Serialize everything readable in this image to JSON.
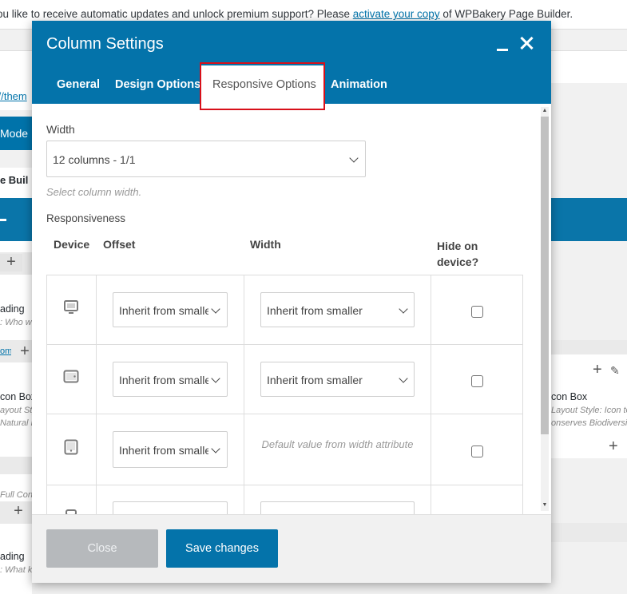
{
  "background": {
    "notice": {
      "text_before": "ou like to receive automatic updates and unlock premium support? Please ",
      "link": "activate your copy",
      "text_after": " of WPBakery Page Builder."
    },
    "url_fragment": "://them",
    "mode_label": "Mode",
    "builder_title": "ge Buil",
    "left_items": [
      {
        "title": "ading",
        "subtitle": ": Who w"
      },
      {
        "title": "con Box",
        "subtitle": "ayout Sty",
        "subtitle2": "Natural F"
      },
      {
        "title": "ading",
        "subtitle": ": What k"
      }
    ],
    "left_link": "om",
    "left_misc": "Full  Con",
    "right_item": {
      "title": "con Box",
      "subtitle": "Layout Style: Icon top",
      "subtitle2": "onserves Biodiversity"
    }
  },
  "modal": {
    "title": "Column Settings",
    "tabs": [
      {
        "label": "General"
      },
      {
        "label": "Design Options"
      },
      {
        "label": "Responsive Options",
        "active": true
      },
      {
        "label": "Animation"
      }
    ],
    "width_label": "Width",
    "width_value": "12 columns - 1/1",
    "width_hint": "Select column width.",
    "responsiveness_label": "Responsiveness",
    "table": {
      "headers": {
        "device": "Device",
        "offset": "Offset",
        "width": "Width",
        "hide": "Hide on device?"
      },
      "rows": [
        {
          "device_icon": "desktop-icon",
          "offset": "Inherit from smaller",
          "width": "Inherit from smaller",
          "hidden": false
        },
        {
          "device_icon": "tablet-landscape-icon",
          "offset": "Inherit from smaller",
          "width": "Inherit from smaller",
          "hidden": false
        },
        {
          "device_icon": "tablet-portrait-icon",
          "offset": "Inherit from smaller",
          "width_note": "Default value from width attribute",
          "hidden": false
        },
        {
          "device_icon": "mobile-icon"
        }
      ]
    },
    "buttons": {
      "close": "Close",
      "save": "Save changes"
    }
  },
  "colors": {
    "brand": "#0473aa",
    "highlight": "#d8101a",
    "close_button": "#b6b9bc"
  }
}
